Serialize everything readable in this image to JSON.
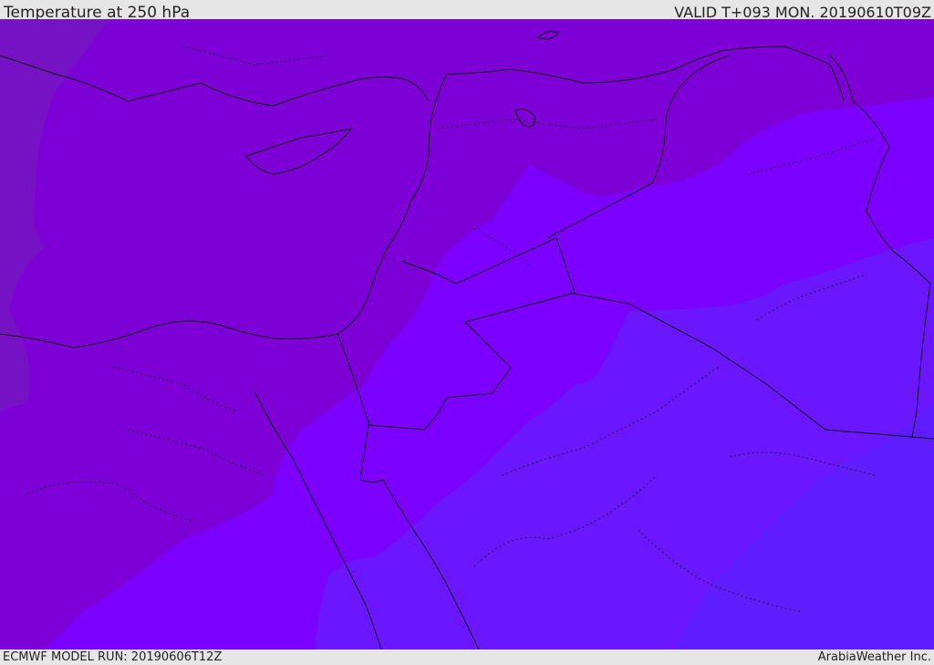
{
  "header": {
    "title": "Temperature at 250 hPa",
    "valid": "VALID T+093 MON. 20190610T09Z"
  },
  "footer": {
    "model_run": "ECMWF MODEL RUN: 20190606T12Z",
    "credit": "ArabiaWeather Inc."
  },
  "map": {
    "colors": {
      "coldest": "#7b0dc9",
      "cold": "#8000d8",
      "mid": "#7b00ff",
      "warm": "#6b14ff",
      "warmest": "#5a1fff",
      "border": "#111111"
    }
  }
}
